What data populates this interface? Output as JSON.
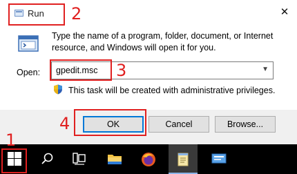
{
  "dialog": {
    "title": "Run",
    "close_glyph": "✕",
    "description": "Type the name of a program, folder, document, or Internet resource, and Windows will open it for you.",
    "open_label": "Open:",
    "open_value": "gpedit.msc",
    "admin_note": "This task will be created with administrative privileges.",
    "buttons": {
      "ok": "OK",
      "cancel": "Cancel",
      "browse": "Browse..."
    }
  },
  "annotations": {
    "step1": "1",
    "step2": "2",
    "step3": "3",
    "step4": "4",
    "color": "#e02020"
  },
  "taskbar": {
    "items": [
      "start-icon",
      "search-icon",
      "task-view-icon",
      "file-explorer-icon",
      "firefox-icon",
      "notepad-icon",
      "server-manager-icon"
    ],
    "background": "#000000"
  }
}
